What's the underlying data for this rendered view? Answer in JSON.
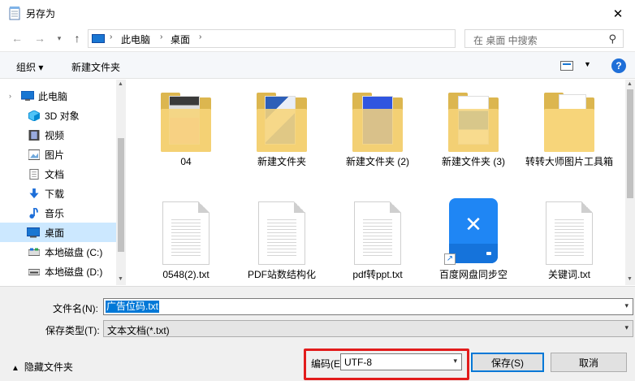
{
  "window": {
    "title": "另存为"
  },
  "address": {
    "crumbs": [
      "此电脑",
      "桌面"
    ],
    "search_placeholder": "在 桌面 中搜索"
  },
  "toolbar": {
    "organize": "组织 ▾",
    "new_folder": "新建文件夹",
    "help": "?"
  },
  "nav": {
    "items": [
      {
        "label": "此电脑",
        "icon": "pc-icon"
      },
      {
        "label": "3D 对象",
        "icon": "cube-icon"
      },
      {
        "label": "视频",
        "icon": "video-icon"
      },
      {
        "label": "图片",
        "icon": "picture-icon"
      },
      {
        "label": "文档",
        "icon": "document-icon"
      },
      {
        "label": "下载",
        "icon": "download-icon"
      },
      {
        "label": "音乐",
        "icon": "music-icon"
      },
      {
        "label": "桌面",
        "icon": "desktop-icon",
        "selected": true
      },
      {
        "label": "本地磁盘 (C:)",
        "icon": "drive-icon"
      },
      {
        "label": "本地磁盘 (D:)",
        "icon": "drive-icon"
      }
    ]
  },
  "files": [
    {
      "label": "04",
      "kind": "folder-image"
    },
    {
      "label": "新建文件夹",
      "kind": "folder-image"
    },
    {
      "label": "新建文件夹 (2)",
      "kind": "folder-image"
    },
    {
      "label": "新建文件夹 (3)",
      "kind": "folder-image"
    },
    {
      "label": "转转大师图片工具箱",
      "kind": "folder"
    },
    {
      "label": "0548(2).txt",
      "kind": "text-file"
    },
    {
      "label": "PDF站数结构化",
      "kind": "text-file"
    },
    {
      "label": "pdf转ppt.txt",
      "kind": "text-file"
    },
    {
      "label": "百度网盘同步空",
      "kind": "app-shortcut"
    },
    {
      "label": "关键词.txt",
      "kind": "text-file"
    }
  ],
  "form": {
    "filename_label": "文件名(N):",
    "filename_value": "广告位码.txt",
    "filetype_label": "保存类型(T):",
    "filetype_value": "文本文档(*.txt)",
    "encoding_label": "编码(E):",
    "encoding_value": "UTF-8",
    "hide_folders": "隐藏文件夹",
    "save_button": "保存(S)",
    "cancel_button": "取消"
  },
  "colors": {
    "accent": "#0078d7",
    "highlight": "#e21c1c",
    "selection": "#cce8ff"
  }
}
